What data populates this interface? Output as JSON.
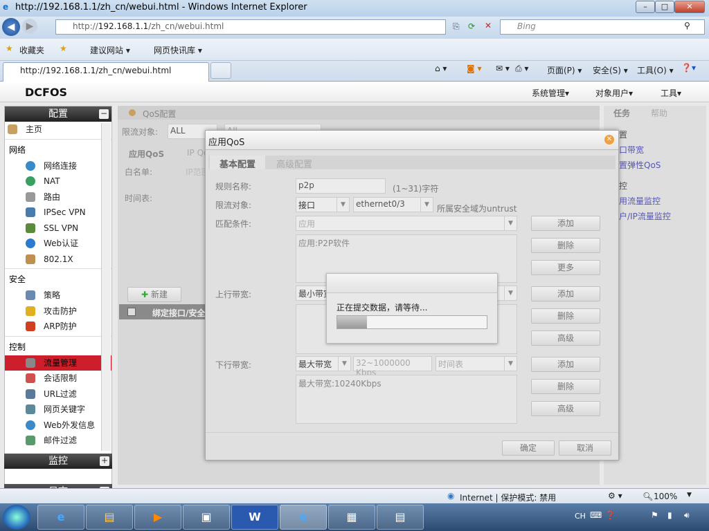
{
  "browser": {
    "title": "http://192.168.1.1/zh_cn/webui.html - Windows Internet Explorer",
    "address_prefix": "http://",
    "address_host": "192.168.1.1",
    "address_path": "/zh_cn/webui.html",
    "search_placeholder": "Bing",
    "favorites": "收藏夹",
    "suggested": "建议网站 ▾",
    "web_slice": "网页快讯库 ▾",
    "tab_title": "http://192.168.1.1/zh_cn/webui.html",
    "cmd": {
      "page": "页面(P) ▾",
      "safety": "安全(S) ▾",
      "tools": "工具(O) ▾"
    }
  },
  "app": {
    "logo": "DCFOS",
    "menu": [
      "系统管理▾",
      "对象用户▾",
      "工具▾"
    ]
  },
  "sidebar": {
    "header": "配置",
    "home": "主页",
    "sections": [
      {
        "title": "网络",
        "items": [
          "网络连接",
          "NAT",
          "路由",
          "IPSec VPN",
          "SSL VPN",
          "Web认证",
          "802.1X"
        ]
      },
      {
        "title": "安全",
        "items": [
          "策略",
          "攻击防护",
          "ARP防护"
        ]
      },
      {
        "title": "控制",
        "items": [
          "流量管理",
          "会话限制",
          "URL过滤",
          "网页关键字",
          "Web外发信息",
          "邮件过滤"
        ]
      }
    ],
    "active": "流量管理",
    "monitor": "监控",
    "log": "日志"
  },
  "content": {
    "title": "QoS配置",
    "limit_label": "限流对象:",
    "limit_value": "ALL",
    "limit_value2": "All",
    "tabs": [
      "应用QoS",
      "IP QoS"
    ],
    "whitelist_label": "白名单:",
    "whitelist_placeholder": "IP范围",
    "schedule_label": "时间表:",
    "new_button": "新建",
    "table_header": "绑定接口/安全域"
  },
  "right_panel": {
    "tabs": [
      "任务",
      "帮助"
    ],
    "groups": [
      {
        "title": "配置",
        "links": [
          "接口带宽",
          "配置弹性QoS"
        ]
      },
      {
        "title": "监控",
        "links": [
          "应用流量监控",
          "用户/IP流量监控"
        ]
      }
    ]
  },
  "dialog": {
    "title": "应用QoS",
    "tabs": [
      "基本配置",
      "高级配置"
    ],
    "rule_name_label": "规则名称:",
    "rule_name": "p2p",
    "rule_name_hint": "(1~31)字符",
    "limit_label": "限流对象:",
    "limit_type": "接口",
    "limit_iface": "ethernet0/3",
    "zone_hint": "所属安全域为untrust",
    "match_label": "匹配条件:",
    "match_value": "应用",
    "match_list": "应用:P2P软件",
    "up_label": "上行带宽:",
    "up_type": "最小带宽",
    "down_label": "下行带宽:",
    "down_type": "最大带宽",
    "down_range": "32~1000000 Kbps",
    "down_schedule": "时间表",
    "down_list": "最大带宽:10240Kbps",
    "btn_add": "添加",
    "btn_delete": "删除",
    "btn_more": "更多",
    "btn_advanced": "高级",
    "ok": "确定",
    "cancel": "取消"
  },
  "progress": {
    "message": "正在提交数据，请等待...",
    "percent": 20
  },
  "statusbar": {
    "zone": "Internet | 保护模式: 禁用",
    "zoom": "100%"
  },
  "taskbar": {
    "lang": "CH"
  }
}
